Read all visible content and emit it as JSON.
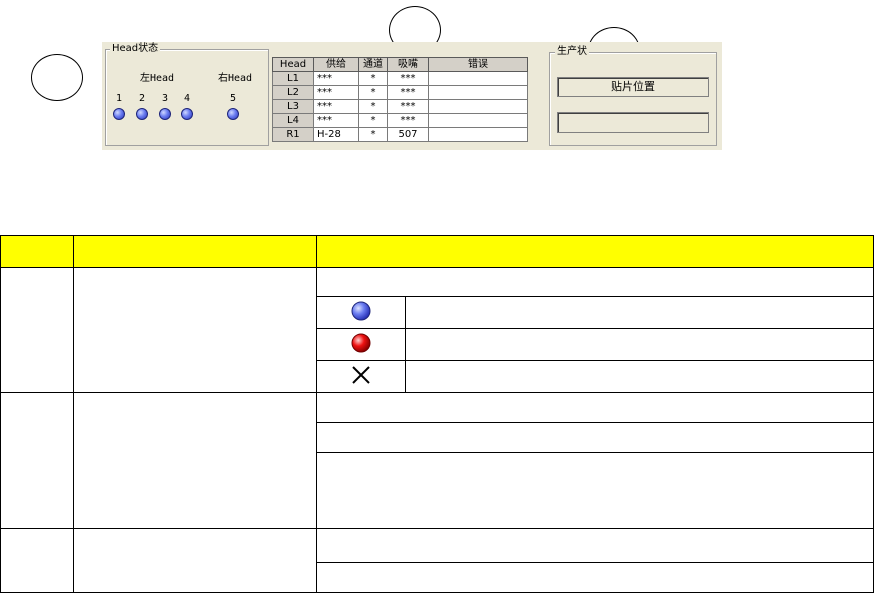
{
  "head_panel": {
    "legend": "Head状态",
    "left_head": "左Head",
    "right_head": "右Head",
    "nozzles": [
      "1",
      "2",
      "3",
      "4",
      "5"
    ],
    "table": {
      "columns": [
        "Head",
        "供给",
        "通道",
        "吸嘴",
        "错误"
      ],
      "rows": [
        [
          "L1",
          "***",
          "*",
          "***",
          ""
        ],
        [
          "L2",
          "***",
          "*",
          "***",
          ""
        ],
        [
          "L3",
          "***",
          "*",
          "***",
          ""
        ],
        [
          "L4",
          "***",
          "*",
          "***",
          ""
        ],
        [
          "R1",
          "H-28",
          "*",
          "507",
          ""
        ]
      ]
    }
  },
  "production_panel": {
    "legend": "生产状",
    "field1": "贴片位置",
    "field2": ""
  },
  "legend_table": {
    "header": [
      "",
      "",
      ""
    ],
    "icons": [
      "blue-ball-icon",
      "red-ball-icon",
      "x-cross-icon"
    ]
  },
  "colors": {
    "header_bg": "#ffff00",
    "panel_bg": "#ece9d8",
    "blue_led": "#5566ee",
    "red_led": "#e00000"
  }
}
